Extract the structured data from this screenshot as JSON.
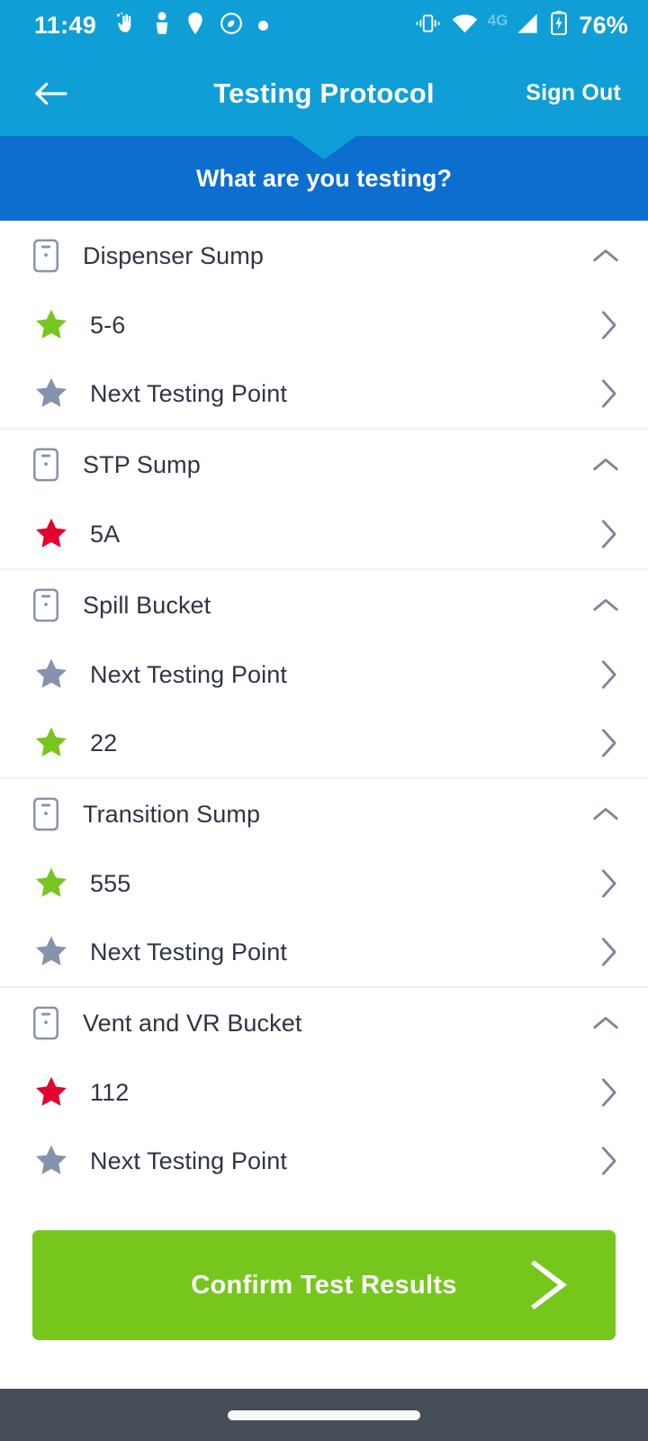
{
  "status_bar": {
    "time": "11:49",
    "battery_percent": "76%",
    "network_type": "4G",
    "left_icons": [
      "hand-sparkle-icon",
      "person-icon",
      "location-pin-icon",
      "do-not-disturb-icon",
      "dot-icon"
    ],
    "right_icons": [
      "vibrate-icon",
      "wifi-icon",
      "signal-icon",
      "battery-charging-icon"
    ]
  },
  "app_bar": {
    "back_label": "back-arrow",
    "title": "Testing Protocol",
    "sign_out": "Sign Out"
  },
  "banner": {
    "question": "What are you testing?"
  },
  "groups": [
    {
      "name": "Dispenser Sump",
      "expanded": true,
      "points": [
        {
          "label": "5-6",
          "status": "pass"
        },
        {
          "label": "Next Testing Point",
          "status": "pending"
        }
      ]
    },
    {
      "name": "STP Sump",
      "expanded": true,
      "points": [
        {
          "label": "5A",
          "status": "fail"
        }
      ]
    },
    {
      "name": "Spill Bucket",
      "expanded": true,
      "points": [
        {
          "label": "Next Testing Point",
          "status": "pending"
        },
        {
          "label": "22",
          "status": "pass"
        }
      ]
    },
    {
      "name": "Transition Sump",
      "expanded": true,
      "points": [
        {
          "label": "555",
          "status": "pass"
        },
        {
          "label": "Next Testing Point",
          "status": "pending"
        }
      ]
    },
    {
      "name": "Vent and VR Bucket",
      "expanded": true,
      "points": [
        {
          "label": "112",
          "status": "fail"
        },
        {
          "label": "Next Testing Point",
          "status": "pending"
        }
      ]
    }
  ],
  "confirm_button": {
    "label": "Confirm Test Results"
  },
  "colors": {
    "header_blue": "#0f9ed6",
    "banner_blue": "#0c6fd0",
    "pass_green": "#76c61e",
    "fail_red": "#e4032e",
    "pending_gray": "#8793ab",
    "text_dark": "#2e3545",
    "nav_bar": "#464e57"
  }
}
